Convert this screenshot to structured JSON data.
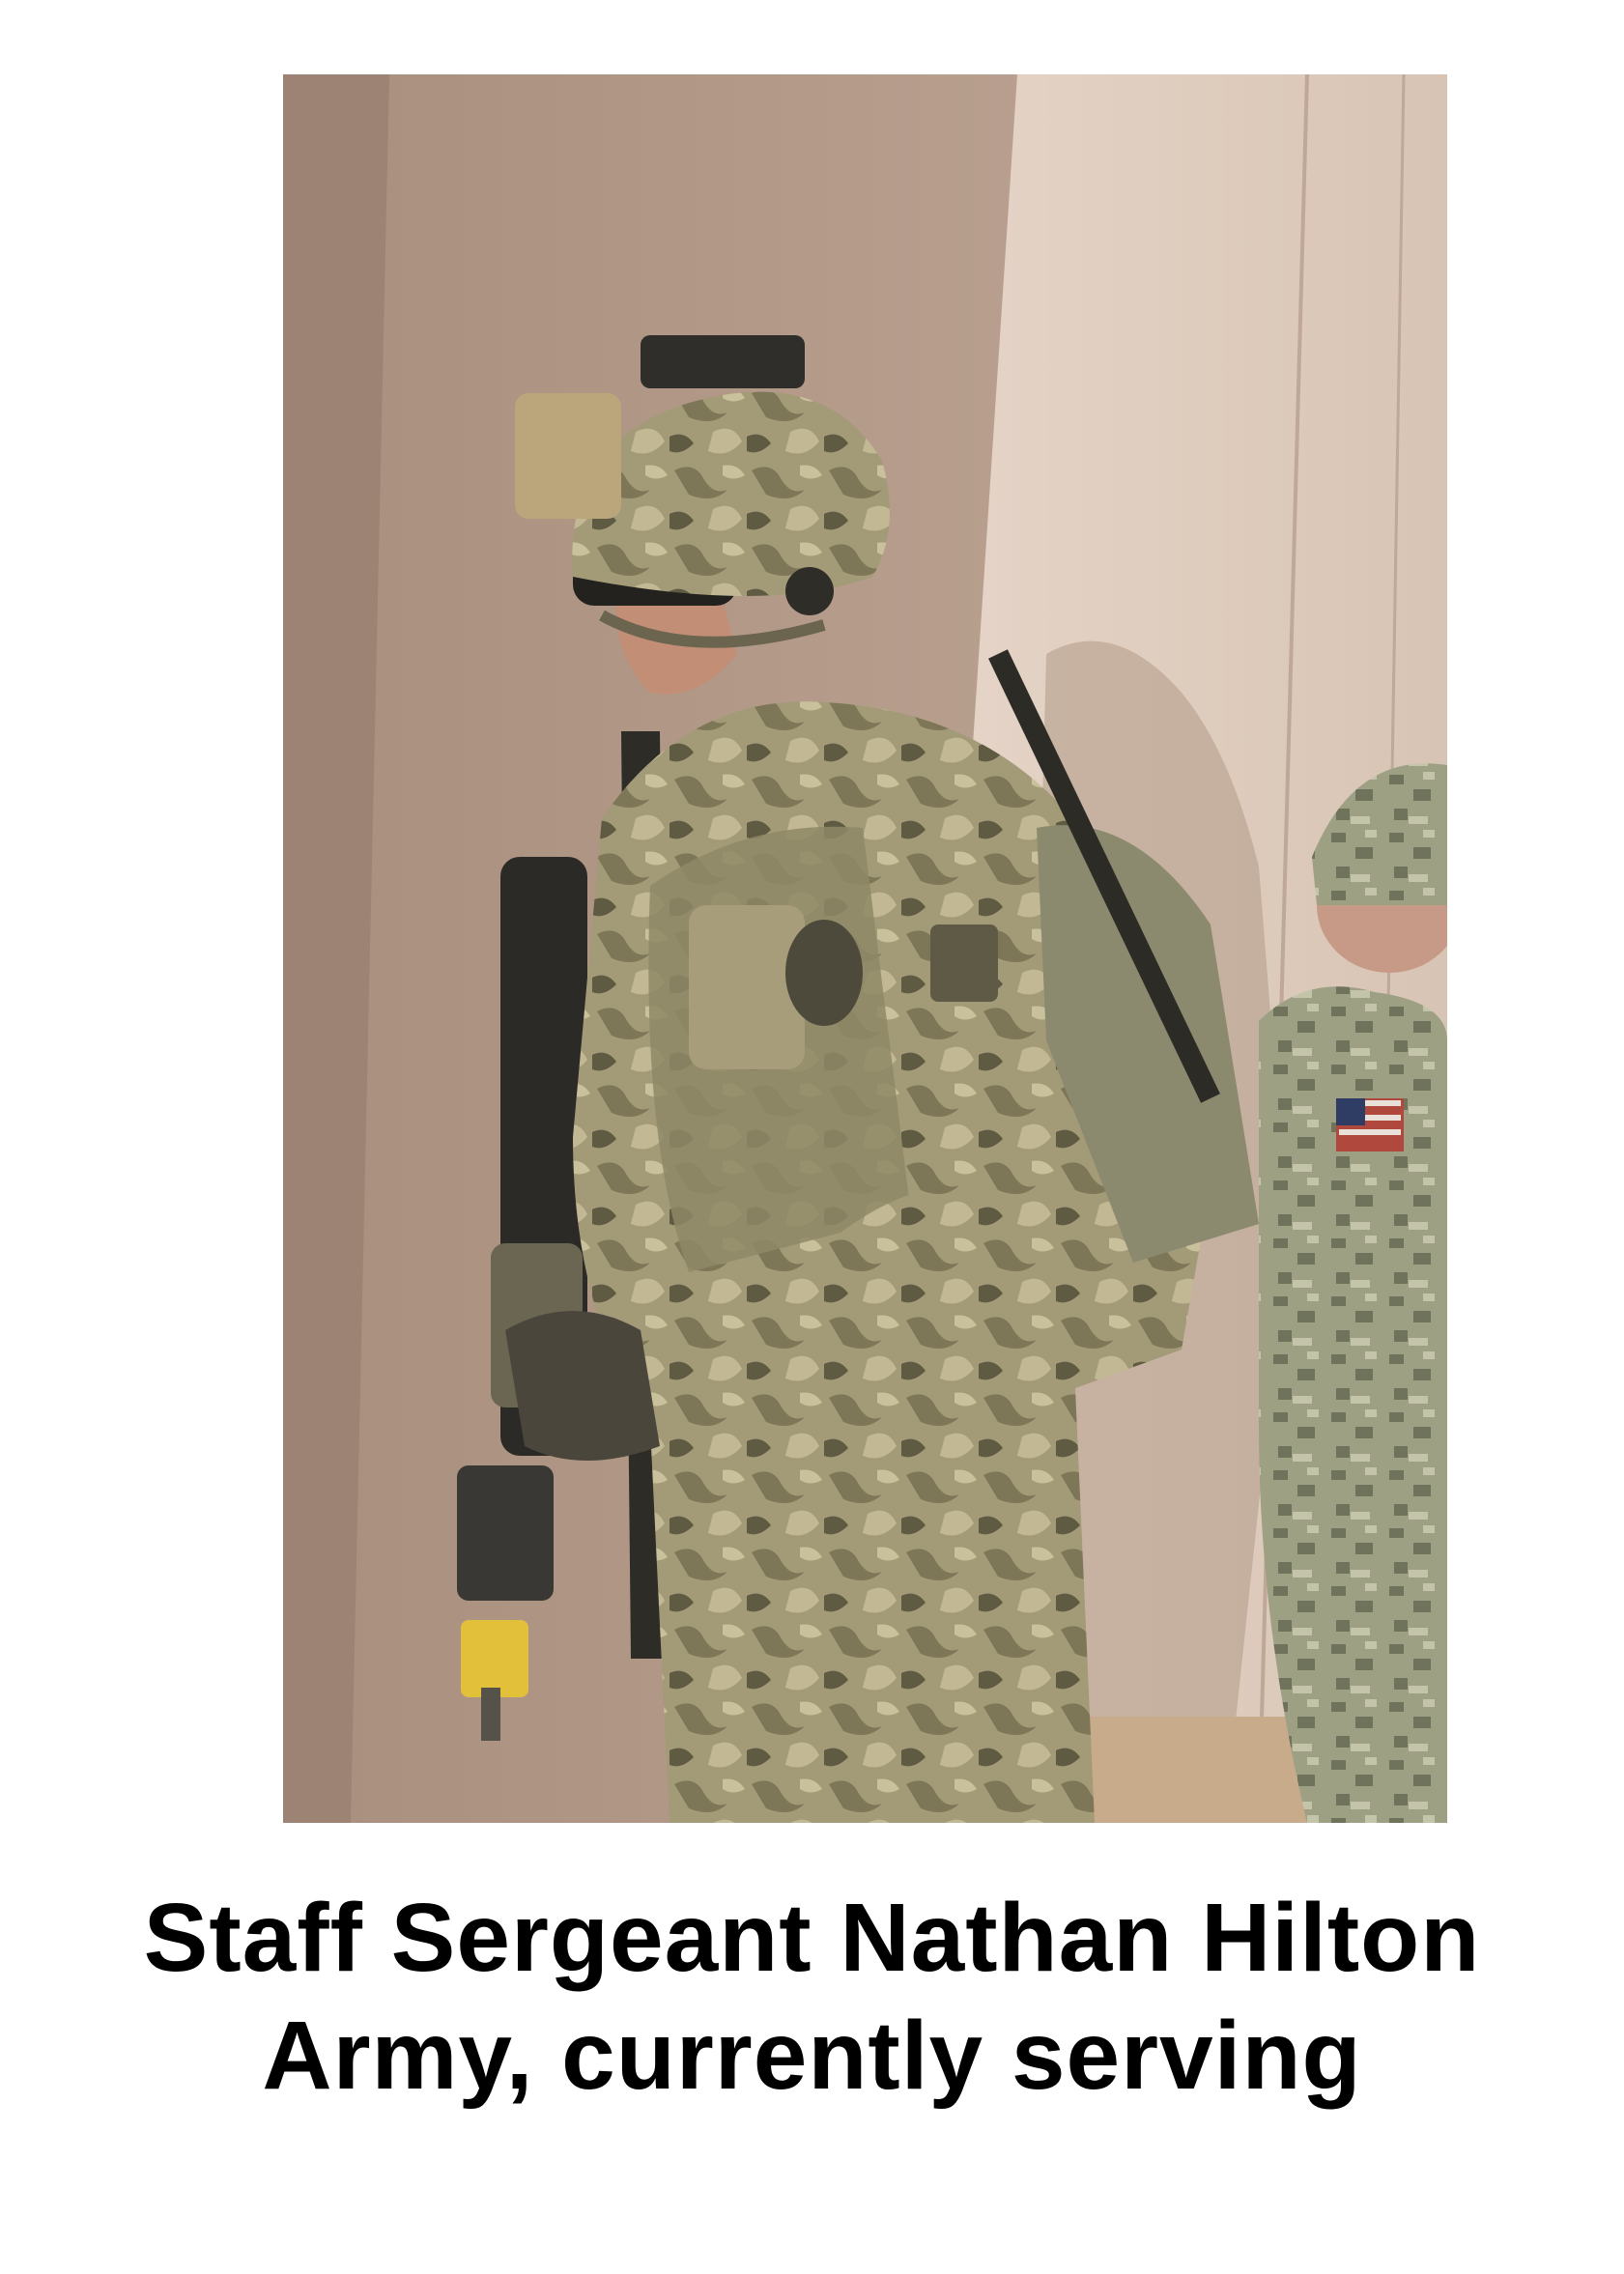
{
  "photo": {
    "alt": "soldier-photo"
  },
  "caption": {
    "line1": "Staff Sergeant Nathan Hilton",
    "line2": "Army, currently serving"
  }
}
